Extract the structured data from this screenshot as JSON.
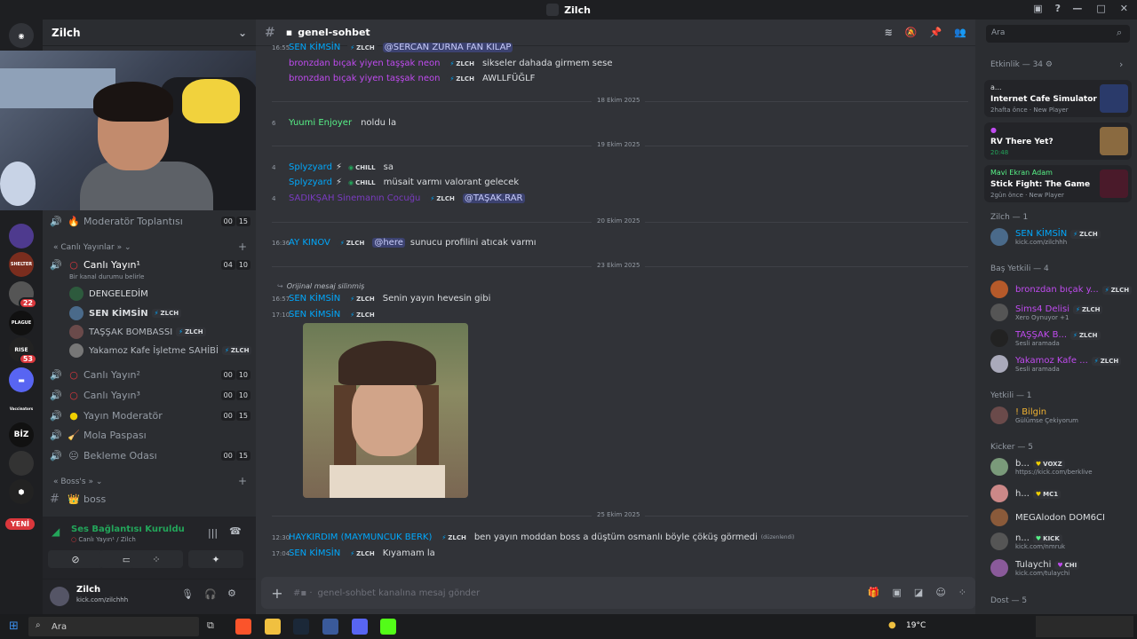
{
  "window": {
    "title": "Zilch"
  },
  "server": {
    "name": "Zilch"
  },
  "server_rail": {
    "badges": [
      "22",
      "53"
    ],
    "labels": [
      "SHELTER",
      "PLAGUE",
      "RISE",
      "Vaccinators",
      "BİZ"
    ],
    "new_label": "YENİ"
  },
  "channels": {
    "top_voice": {
      "name": "Moderatör Toplantısı",
      "counts": [
        "00",
        "15"
      ]
    },
    "category_live": "« Canlı Yayınlar »",
    "live1": {
      "name": "Canlı Yayın¹",
      "counts": [
        "04",
        "10"
      ],
      "status": "Bir kanal durumu belirle"
    },
    "live_members": [
      {
        "name": "DENGELEDİM",
        "tag": ""
      },
      {
        "name": "SEN KİMSİN",
        "tag": "ZLCH"
      },
      {
        "name": "TAŞŞAK BOMBASSI",
        "tag": "ZLCH"
      },
      {
        "name": "Yakamoz Kafe İşletme SAHİBİ",
        "tag": "ZLCH"
      }
    ],
    "live2": {
      "name": "Canlı Yayın²",
      "counts": [
        "00",
        "10"
      ]
    },
    "live3": {
      "name": "Canlı Yayın³",
      "counts": [
        "00",
        "10"
      ]
    },
    "yayin_mod": {
      "name": "Yayın Moderatör",
      "counts": [
        "00",
        "15"
      ]
    },
    "mola": {
      "name": "Mola Paspası"
    },
    "bekleme": {
      "name": "Bekleme Odası",
      "counts": [
        "00",
        "15"
      ]
    },
    "category_boss": "« Boss's »",
    "boss": "boss"
  },
  "voice_panel": {
    "status": "Ses Bağlantısı Kuruldu",
    "sub": "Canlı Yayın¹ / Zilch"
  },
  "user_panel": {
    "name": "Zilch",
    "status": "kick.com/zilchhh"
  },
  "chat": {
    "channel": "genel-sohbet",
    "composer_placeholder": "genel-sohbet kanalına mesaj gönder",
    "messages_top": [
      {
        "time": "16:55",
        "name": "SEN KİMSİN",
        "tag": "ZLCH",
        "mention": "@SERCAN ZURNA FAN KILAP",
        "text": ""
      },
      {
        "time": "",
        "name": "bronzdan bıçak yiyen taşşak neon",
        "tag": "ZLCH",
        "mention": "",
        "text": "sikseler dahada girmem sese"
      },
      {
        "time": "",
        "name": "bronzdan bıçak yiyen taşşak neon",
        "tag": "ZLCH",
        "mention": "",
        "text": "AWLLFÜĞLF"
      }
    ],
    "date1": "18 Ekim 2025",
    "msg_yuumi": {
      "time": "6",
      "name": "Yuumi Enjoyer",
      "text": "noldu la"
    },
    "date2": "19 Ekim 2025",
    "msgs_19": [
      {
        "time": "4",
        "name": "Splyzyard",
        "tag": "CHILL",
        "mention": "",
        "text": "sa"
      },
      {
        "time": "",
        "name": "Splyzyard",
        "tag": "CHILL",
        "mention": "",
        "text": "müsait varmı valorant gelecek"
      },
      {
        "time": "4",
        "name": "SADIKŞAH Sinemanın Cocuğu",
        "tag": "ZLCH",
        "mention": "@TAŞAK.RAR",
        "text": ""
      }
    ],
    "date3": "20 Ekim 2025",
    "msg_ay": {
      "time": "16:36",
      "name": "AY KINOV",
      "tag": "ZLCH",
      "mention": "@here",
      "text": "sunucu profilini atıcak varmı"
    },
    "date4": "23 Ekim 2025",
    "reply_note": "Orijinal mesaj silinmiş",
    "msg_sen1": {
      "time": "16:57",
      "name": "SEN KİMSİN",
      "tag": "ZLCH",
      "text": "Senin yayın hevesin gibi"
    },
    "msg_sen2": {
      "time": "17:10",
      "name": "SEN KİMSİN",
      "tag": "ZLCH"
    },
    "date5": "25 Ekim 2025",
    "msg_hay": {
      "time": "12:30",
      "name": "HAYKIRDIM (MAYMUNCUK BERK)",
      "tag": "ZLCH",
      "text": "ben yayın moddan boss a düştüm osmanlı böyle çöküş görmedi",
      "edited": "(düzenlendi)"
    },
    "msg_last": {
      "time": "17:04",
      "name": "SEN KİMSİN",
      "tag": "ZLCH",
      "text": "Kıyamam la"
    }
  },
  "members": {
    "search_placeholder": "Ara",
    "activity_header": "Etkinlik — 34",
    "activities": [
      {
        "who": "a...",
        "title": "Internet Cafe Simulator",
        "meta": "2hafta önce · New Player"
      },
      {
        "who": "",
        "title": "RV There Yet?",
        "meta": "20:48"
      },
      {
        "who": "Mavi Ekran Adam",
        "title": "Stick Fight: The Game",
        "meta": "2gün önce · New Player"
      }
    ],
    "groups": [
      {
        "header": "Zilch — 1",
        "items": [
          {
            "name": "SEN KİMSİN",
            "tag": "ZLCH",
            "sub": "kick.com/zilchhh",
            "color": "#00a8fc"
          }
        ]
      },
      {
        "header": "Baş Yetkili — 4",
        "items": [
          {
            "name": "bronzdan bıçak y...",
            "tag": "ZLCH",
            "sub": "",
            "color": "#c04bf0"
          },
          {
            "name": "Sims4 Delisi",
            "tag": "ZLCH",
            "sub": "Xero Oynuyor +1",
            "color": "#c04bf0"
          },
          {
            "name": "TAŞŞAK B...",
            "tag": "ZLCH",
            "sub": "Sesli aramada",
            "color": "#c04bf0"
          },
          {
            "name": "Yakamoz Kafe ...",
            "tag": "ZLCH",
            "sub": "Sesli aramada",
            "color": "#c04bf0"
          }
        ]
      },
      {
        "header": "Yetkili — 1",
        "items": [
          {
            "name": "! Bilgin",
            "tag": "",
            "sub": "Gülümse Çekiyorum",
            "color": "#f0b232"
          }
        ]
      },
      {
        "header": "Kicker — 5",
        "items": [
          {
            "name": "b...",
            "tag": "VOXZ",
            "sub": "https://kick.com/berklive",
            "color": "#dbdee1"
          },
          {
            "name": "h...",
            "tag": "MC1",
            "sub": "",
            "color": "#dbdee1"
          },
          {
            "name": "MEGAlodon DOM6CI",
            "tag": "",
            "sub": "",
            "color": "#dbdee1"
          },
          {
            "name": "n...",
            "tag": "KICK",
            "sub": "kick.com/nmruk",
            "color": "#dbdee1"
          },
          {
            "name": "Tulaychi",
            "tag": "CHI",
            "sub": "kick.com/tulaychi",
            "color": "#dbdee1"
          }
        ]
      },
      {
        "header": "Dost — 5",
        "items": []
      }
    ]
  },
  "taskbar": {
    "search_label": "Ara",
    "weather": "19°C"
  }
}
